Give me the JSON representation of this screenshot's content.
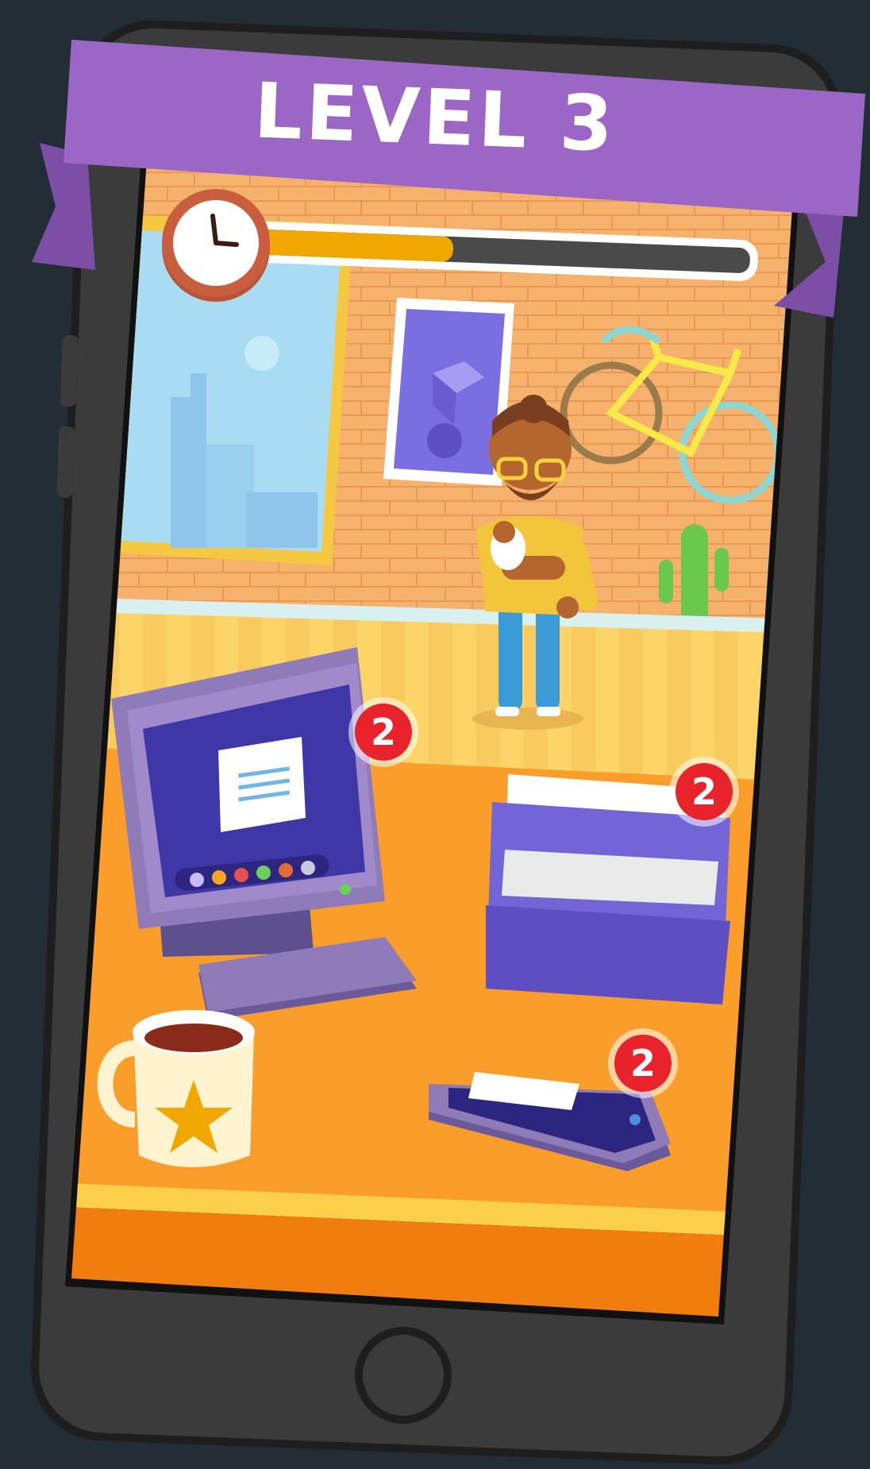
{
  "banner": {
    "title": "LEVEL 3"
  },
  "timer": {
    "progress": 0.42
  },
  "notifications": {
    "computer": "2",
    "inbox_tray": "2",
    "phone": "2"
  },
  "colors": {
    "background": "#232d36",
    "banner": "#9b66c6",
    "timer_fill": "#f0a800",
    "badge": "#e8232b"
  },
  "icons": [
    "wall-clock-icon",
    "bicycle-icon",
    "cactus-icon",
    "coffee-mug-icon",
    "star-icon",
    "home-button-icon"
  ]
}
